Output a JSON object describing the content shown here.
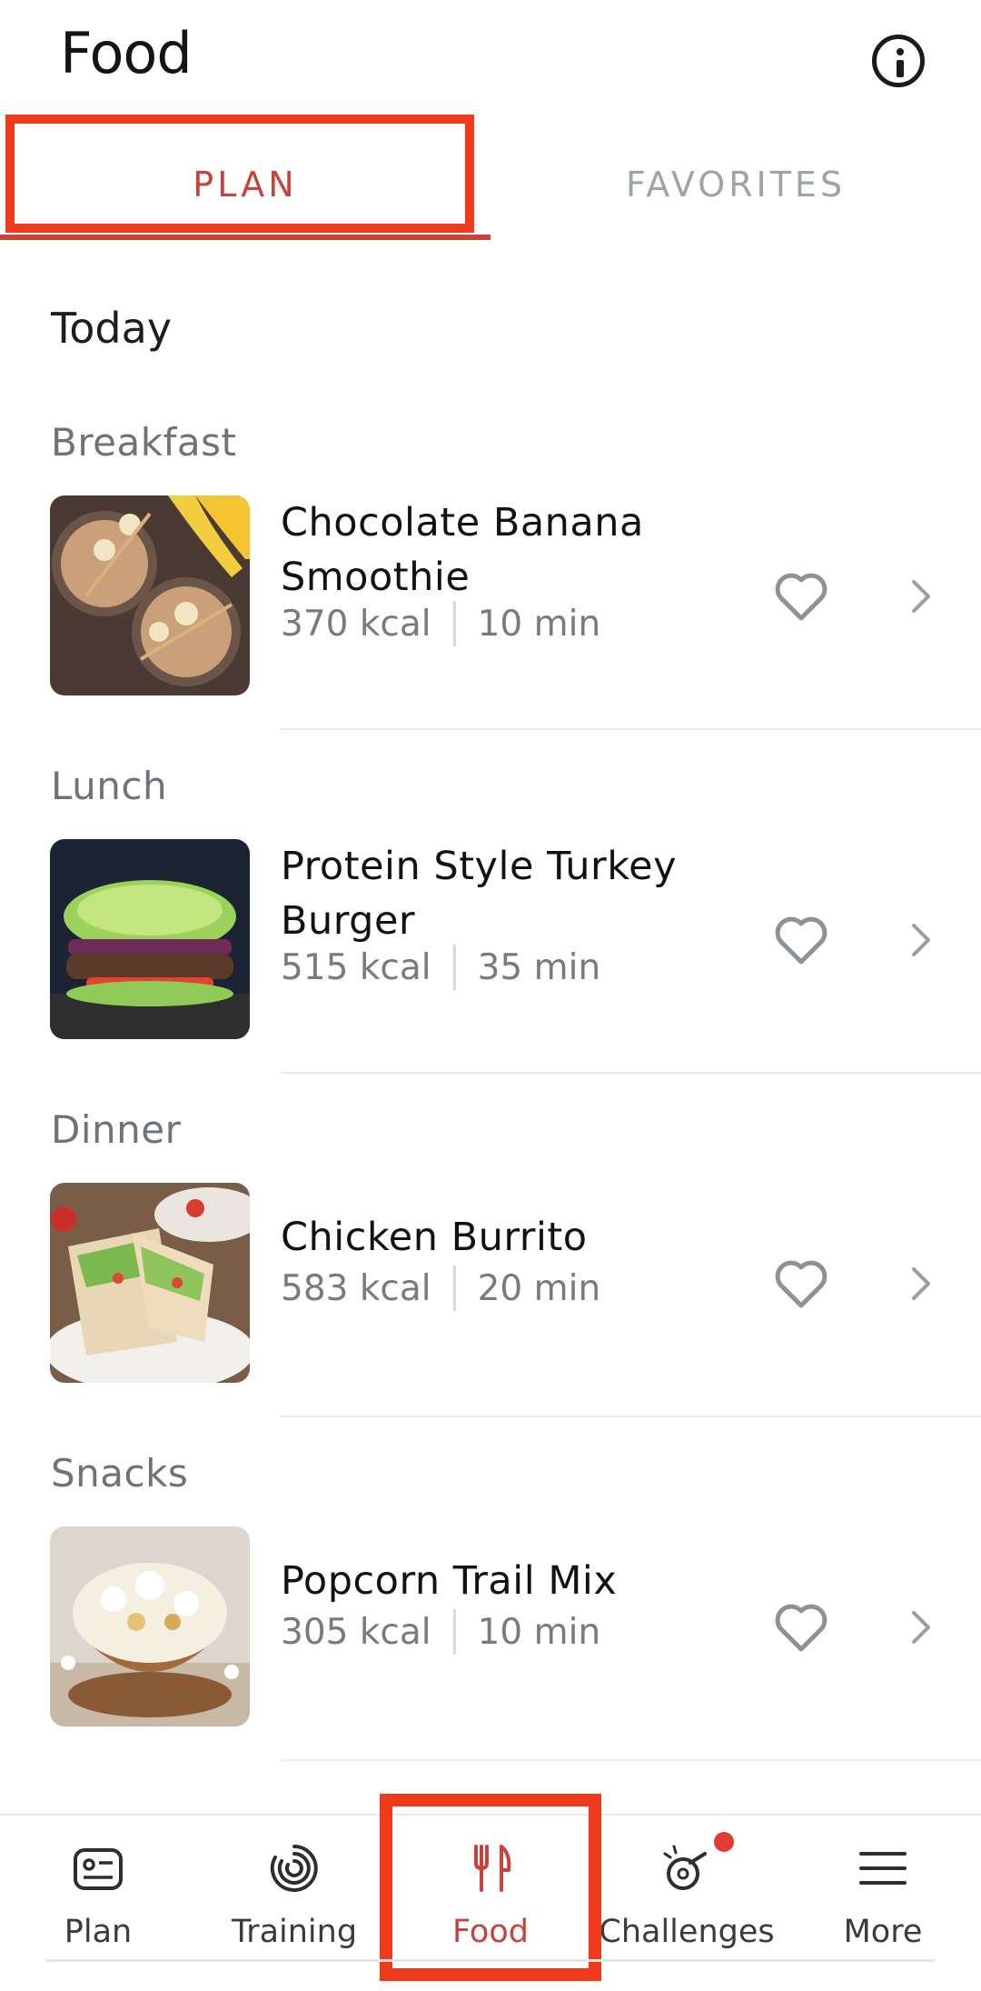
{
  "header": {
    "title": "Food"
  },
  "tabs": [
    {
      "label": "PLAN",
      "active": true
    },
    {
      "label": "FAVORITES",
      "active": false
    }
  ],
  "section_title": "Today",
  "meals": [
    {
      "label": "Breakfast",
      "recipe": {
        "name_line1": "Chocolate Banana",
        "name_line2": "Smoothie",
        "kcal": "370 kcal",
        "time": "10 min"
      }
    },
    {
      "label": "Lunch",
      "recipe": {
        "name_line1": "Protein Style Turkey",
        "name_line2": "Burger",
        "kcal": "515 kcal",
        "time": "35 min"
      }
    },
    {
      "label": "Dinner",
      "recipe": {
        "name_line1": "Chicken Burrito",
        "name_line2": "",
        "kcal": "583 kcal",
        "time": "20 min"
      }
    },
    {
      "label": "Snacks",
      "recipe": {
        "name_line1": "Popcorn Trail Mix",
        "name_line2": "",
        "kcal": "305 kcal",
        "time": "10 min"
      }
    }
  ],
  "bottom_nav": [
    {
      "label": "Plan",
      "icon": "plan-icon"
    },
    {
      "label": "Training",
      "icon": "training-icon"
    },
    {
      "label": "Food",
      "icon": "food-icon",
      "active": true
    },
    {
      "label": "Challenges",
      "icon": "challenges-icon",
      "badge": true
    },
    {
      "label": "More",
      "icon": "menu-icon"
    }
  ],
  "colors": {
    "accent": "#c9423b",
    "highlight": "#ef3a1e",
    "muted": "#777b80"
  }
}
